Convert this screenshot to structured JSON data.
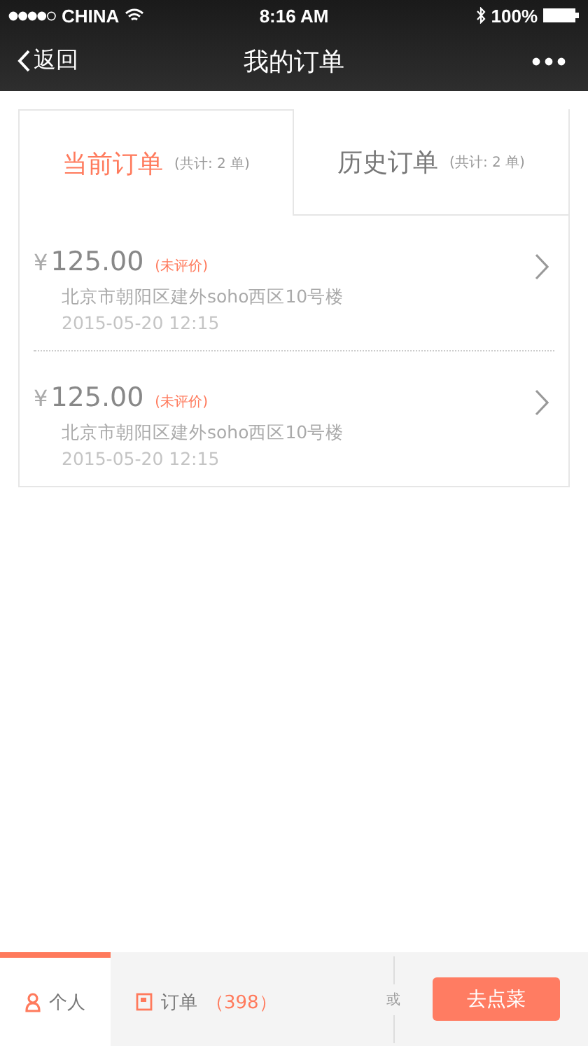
{
  "status_bar": {
    "carrier": "CHINA",
    "time": "8:16 AM",
    "battery": "100%"
  },
  "nav": {
    "back": "返回",
    "title": "我的订单"
  },
  "tabs": [
    {
      "label": "当前订单",
      "count": "(共计: 2 单)",
      "selected": true
    },
    {
      "label": "历史订单",
      "count": "(共计: 2 单)",
      "selected": false
    }
  ],
  "orders": [
    {
      "currency": "¥",
      "amount": "125.00",
      "status": "(未评价)",
      "address": "北京市朝阳区建外soho西区10号楼",
      "time": "2015-05-20 12:15"
    },
    {
      "currency": "¥",
      "amount": "125.00",
      "status": "(未评价)",
      "address": "北京市朝阳区建外soho西区10号楼",
      "time": "2015-05-20 12:15"
    }
  ],
  "bottom_bar": {
    "tabs": [
      {
        "kind": "person",
        "label": "个人",
        "selected": true
      },
      {
        "kind": "order",
        "label": "订单",
        "count": "（398）",
        "selected": false
      }
    ],
    "separator": "或",
    "button": "去点菜"
  }
}
